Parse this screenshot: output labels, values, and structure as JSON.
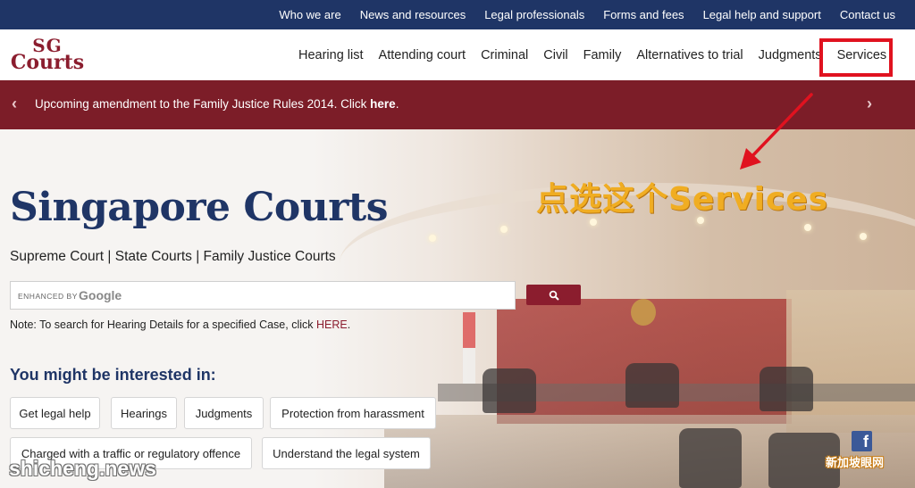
{
  "top_links": [
    "Who we are",
    "News and resources",
    "Legal professionals",
    "Forms and fees",
    "Legal help and support",
    "Contact us"
  ],
  "logo": {
    "line1": "SG",
    "line2": "Courts"
  },
  "nav": {
    "items": [
      "Hearing list",
      "Attending court",
      "Criminal",
      "Civil",
      "Family",
      "Alternatives to trial",
      "Judgments"
    ],
    "services": "Services"
  },
  "banner": {
    "prev": "‹",
    "next": "›",
    "text": "Upcoming amendment to the Family Justice Rules 2014. Click ",
    "link": "here",
    "end": "."
  },
  "hero": {
    "title": "Singapore Courts",
    "subtitle": "Supreme Court | State Courts | Family Justice Courts"
  },
  "search": {
    "enhanced_by": "ENHANCED BY",
    "google": "Google"
  },
  "note": {
    "text": "Note: To search for Hearing Details for a specified Case, click ",
    "link": "HERE",
    "end": "."
  },
  "interest": {
    "heading": "You might be interested in:",
    "tags": [
      "Get legal help",
      "Hearings",
      "Judgments",
      "Protection from harassment",
      "Charged with a traffic or regulatory offence",
      "Understand the legal system"
    ]
  },
  "annotation": "点选这个Services",
  "social": {
    "facebook": "f"
  },
  "watermarks": {
    "left": "shicheng.news",
    "right": "新加坡眼网"
  },
  "colors": {
    "navy": "#1f3566",
    "maroon": "#7c1d28",
    "highlight": "#e0121f",
    "annotation": "#f0ad22"
  }
}
